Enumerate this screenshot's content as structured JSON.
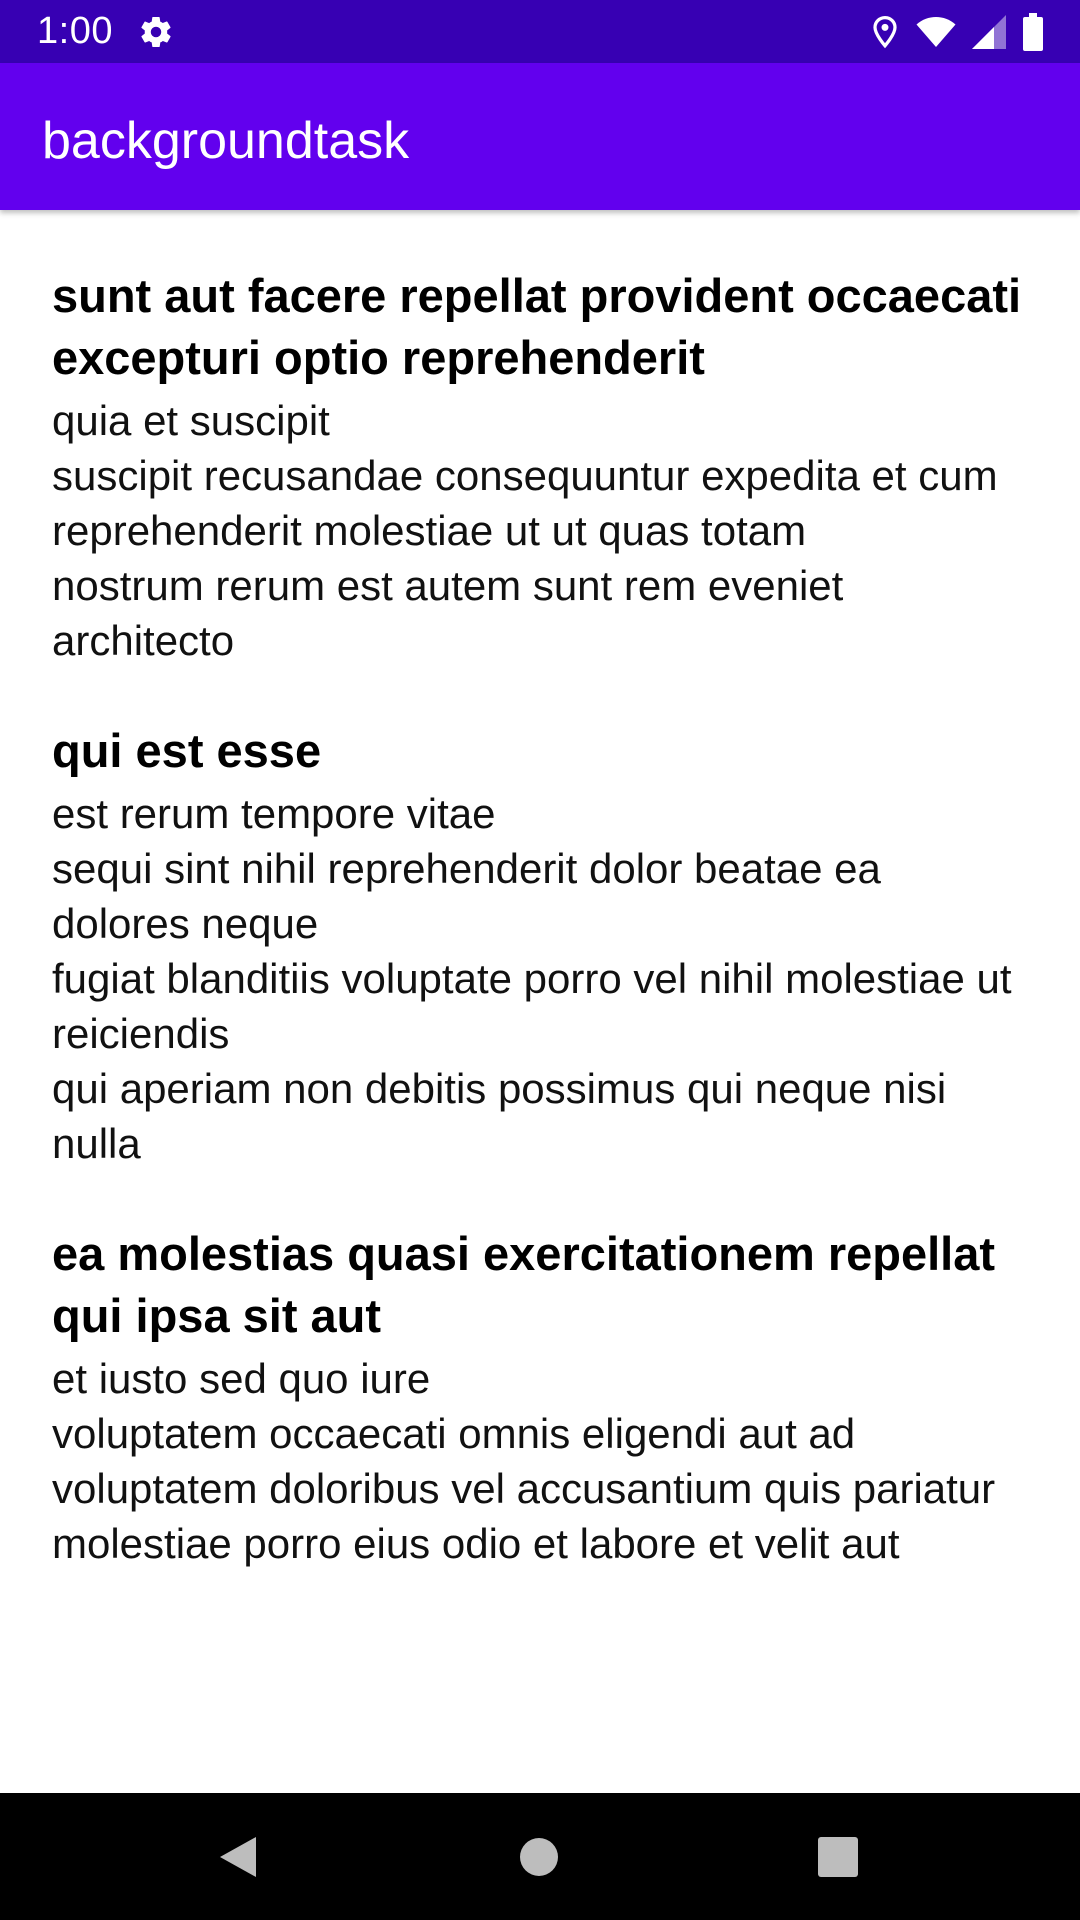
{
  "status_bar": {
    "time": "1:00",
    "icons": [
      "settings-gear-icon",
      "location-icon",
      "wifi-icon",
      "cell-signal-icon",
      "battery-icon"
    ],
    "background": "#3700b3"
  },
  "app_bar": {
    "title": "backgroundtask",
    "background": "#6200ee"
  },
  "posts": [
    {
      "title": "sunt aut facere repellat provident occaecati excepturi optio reprehenderit",
      "body": "quia et suscipit\nsuscipit recusandae consequuntur expedita et cum\nreprehenderit molestiae ut ut quas totam\nnostrum rerum est autem sunt rem eveniet architecto"
    },
    {
      "title": "qui est esse",
      "body": "est rerum tempore vitae\nsequi sint nihil reprehenderit dolor beatae ea dolores neque\nfugiat blanditiis voluptate porro vel nihil molestiae ut reiciendis\nqui aperiam non debitis possimus qui neque nisi nulla"
    },
    {
      "title": "ea molestias quasi exercitationem repellat qui ipsa sit aut",
      "body": "et iusto sed quo iure\nvoluptatem occaecati omnis eligendi aut ad\nvoluptatem doloribus vel accusantium quis pariatur\nmolestiae porro eius odio et labore et velit aut"
    }
  ],
  "nav_bar": {
    "icons": [
      "back-icon",
      "home-icon",
      "recents-icon"
    ]
  }
}
